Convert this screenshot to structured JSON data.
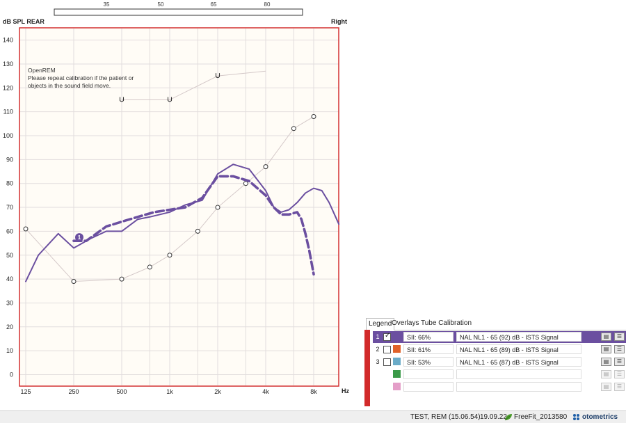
{
  "header": {
    "y_unit": "dB SPL REAR",
    "side": "Right"
  },
  "chart_data": {
    "type": "line",
    "xscale": "log",
    "xlim": [
      125,
      8000
    ],
    "ylim": [
      0,
      140
    ],
    "x_tick_values": [
      125,
      250,
      500,
      1000,
      2000,
      4000,
      8000
    ],
    "x_tick_labels": [
      "125",
      "250",
      "500",
      "1k",
      "2k",
      "4k",
      "8k"
    ],
    "x_unit": "Hz",
    "y_ticks": [
      0,
      10,
      20,
      30,
      40,
      50,
      60,
      70,
      80,
      90,
      100,
      110,
      120,
      130,
      140
    ],
    "top_scale_labels": [
      "35",
      "50",
      "65",
      "80"
    ],
    "grid": true,
    "annotation": {
      "title": "OpenREM",
      "line1": "Please repeat calibration if the patient or",
      "line2": "objects in the sound field move."
    },
    "series": [
      {
        "style": "thin-light",
        "color": "#d4c8c8",
        "marker": "circle",
        "x": [
          125,
          250,
          500,
          750,
          1000,
          1500,
          2000,
          3000,
          4000,
          6000,
          8000
        ],
        "y": [
          61,
          39,
          40,
          45,
          50,
          60,
          70,
          80,
          87,
          103,
          108
        ]
      },
      {
        "style": "thin-light",
        "color": "#d4c8c8",
        "marker": "U",
        "x": [
          500,
          1000,
          2000,
          4000
        ],
        "y": [
          115,
          115,
          125,
          127
        ],
        "marked": [
          true,
          true,
          true,
          false
        ]
      },
      {
        "style": "solid",
        "color": "#6b4fa0",
        "x": [
          125,
          150,
          200,
          250,
          320,
          400,
          500,
          630,
          750,
          1000,
          1250,
          1600,
          2000,
          2500,
          3150,
          4000,
          4500,
          5000,
          5600,
          6300,
          7100,
          8000,
          9000,
          10000,
          11500
        ],
        "y": [
          39,
          50,
          59,
          53,
          57,
          60,
          60,
          65,
          66,
          68,
          71,
          73,
          84,
          88,
          86,
          77,
          70,
          68,
          69,
          72,
          76,
          78,
          77,
          72,
          63
        ]
      },
      {
        "style": "dashed",
        "color": "#6b4fa0",
        "start_label": "1",
        "x": [
          250,
          300,
          400,
          500,
          630,
          800,
          1000,
          1250,
          1600,
          2000,
          2500,
          3150,
          4000,
          4500,
          5000,
          5600,
          6300,
          6700,
          7100,
          7500,
          8000
        ],
        "y": [
          56,
          56,
          62,
          64,
          66,
          68,
          69,
          70,
          74,
          83,
          83,
          81,
          75,
          70,
          67,
          67,
          68,
          65,
          59,
          52,
          42
        ]
      }
    ]
  },
  "legend_panel": {
    "tabs": [
      "Legend",
      "Overlays",
      "Tube Calibration"
    ],
    "rows": [
      {
        "num": "1",
        "checked": true,
        "color": "#6b4fa0",
        "sii": "SII: 66%",
        "desc": "NAL NL1 - 65 (92) dB - ISTS Signal"
      },
      {
        "num": "2",
        "checked": false,
        "color": "#e0622a",
        "sii": "SII: 61%",
        "desc": "NAL NL1 - 65 (89) dB - ISTS Signal"
      },
      {
        "num": "3",
        "checked": false,
        "color": "#6aabc8",
        "sii": "SII: 53%",
        "desc": "NAL NL1 - 65 (87) dB - ISTS Signal"
      },
      {
        "num": "",
        "checked": null,
        "color": "#3a9a48",
        "sii": "",
        "desc": ""
      },
      {
        "num": "",
        "checked": null,
        "color": "#e49ec8",
        "sii": "",
        "desc": ""
      }
    ],
    "check_mark": "✓",
    "button_glyphs": [
      "▤",
      "☰"
    ]
  },
  "status": {
    "session": "TEST, REM (15.06.54)",
    "date": "19.09.22",
    "fit": "FreeFit_2013580",
    "brand": "otometrics"
  }
}
